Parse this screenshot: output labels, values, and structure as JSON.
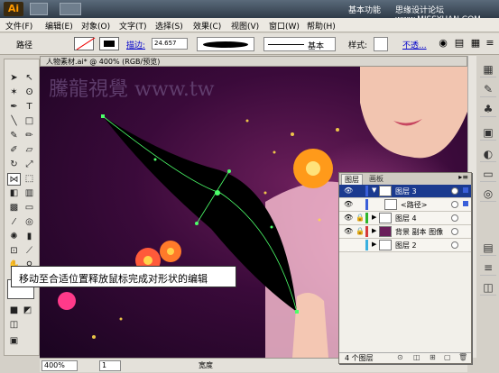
{
  "app": {
    "logo": "Ai",
    "workspace": "基本功能",
    "watermark": "思缘设计论坛 www.MISSYUAN.COM"
  },
  "menu": [
    "文件(F)",
    "编辑(E)",
    "对象(O)",
    "文字(T)",
    "选择(S)",
    "效果(C)",
    "视图(V)",
    "窗口(W)",
    "帮助(H)"
  ],
  "control": {
    "selection_type": "路径",
    "stroke_label": "描边:",
    "stroke_value": "24.657",
    "stroke_style": "基本",
    "style_label": "样式:",
    "opacity_label": "不透..."
  },
  "document": {
    "title": "人物素材.ai* @ 400% (RGB/预览)",
    "watermark": "騰龍視覺 www.tw"
  },
  "layers_panel": {
    "tabs": [
      "图层",
      "画板"
    ],
    "rows": [
      {
        "name": "图层 3",
        "selected": true,
        "color": "#3a5fd9"
      },
      {
        "name": "<路径>",
        "selected": false,
        "color": "#3a5fd9"
      },
      {
        "name": "图层 4",
        "selected": false,
        "color": "#2db52d"
      },
      {
        "name": "背景 副本 图像",
        "selected": false,
        "color": "#d43b3b"
      },
      {
        "name": "图层 2",
        "selected": false,
        "color": "#3ab0e0"
      }
    ],
    "count": "4 个图层"
  },
  "status": {
    "zoom": "400%",
    "page": "1",
    "text": "宽度"
  },
  "caption": "移动至合适位置释放鼠标完成对形状的编辑",
  "icons": {
    "dock": [
      "swatches-icon",
      "brush-icon",
      "symbol-icon",
      "graphic-style-icon",
      "color-icon",
      "gradient-icon",
      "transparency-icon",
      "align-icon",
      "stroke-icon",
      "layers-icon"
    ]
  }
}
